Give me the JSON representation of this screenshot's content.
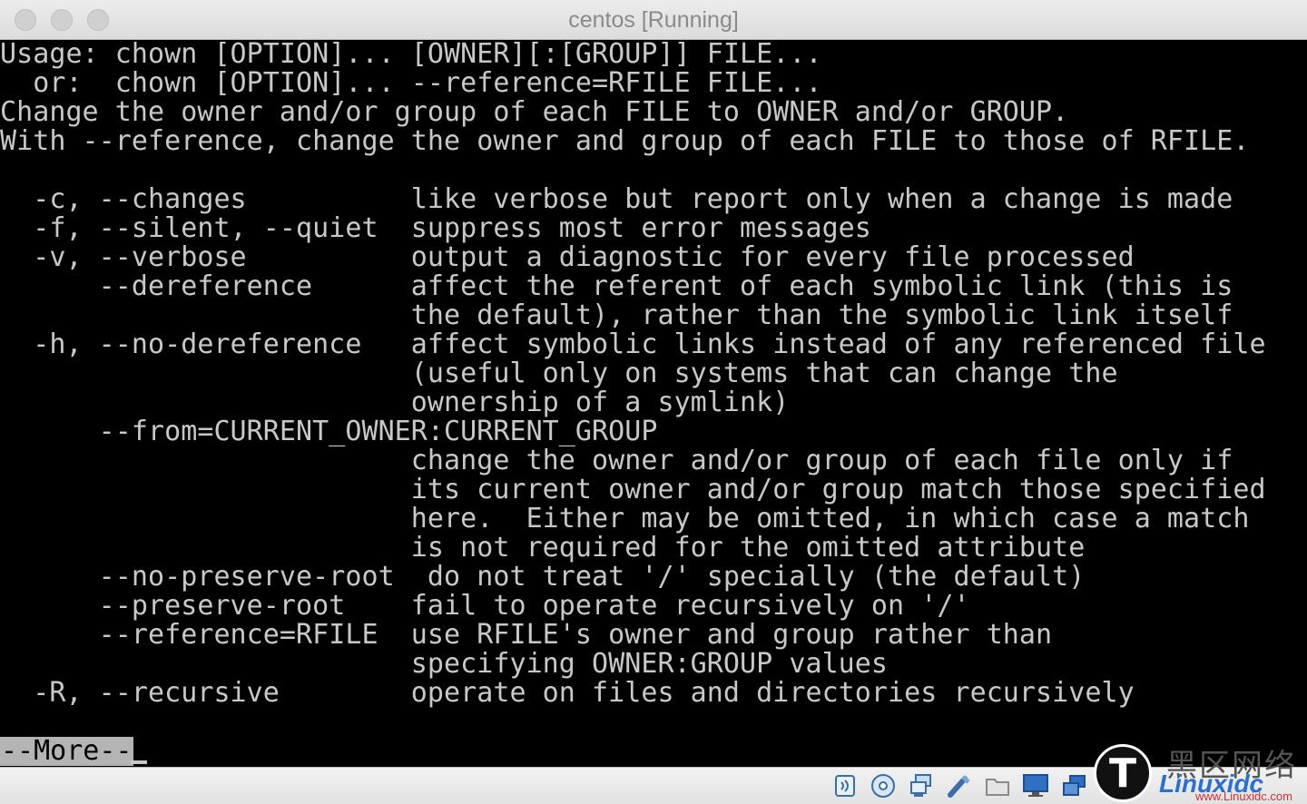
{
  "window": {
    "title": "centos [Running]"
  },
  "terminal": {
    "lines": [
      "Usage: chown [OPTION]... [OWNER][:[GROUP]] FILE...",
      "  or:  chown [OPTION]... --reference=RFILE FILE...",
      "Change the owner and/or group of each FILE to OWNER and/or GROUP.",
      "With --reference, change the owner and group of each FILE to those of RFILE.",
      "",
      "  -c, --changes          like verbose but report only when a change is made",
      "  -f, --silent, --quiet  suppress most error messages",
      "  -v, --verbose          output a diagnostic for every file processed",
      "      --dereference      affect the referent of each symbolic link (this is",
      "                         the default), rather than the symbolic link itself",
      "  -h, --no-dereference   affect symbolic links instead of any referenced file",
      "                         (useful only on systems that can change the",
      "                         ownership of a symlink)",
      "      --from=CURRENT_OWNER:CURRENT_GROUP",
      "                         change the owner and/or group of each file only if",
      "                         its current owner and/or group match those specified",
      "                         here.  Either may be omitted, in which case a match",
      "                         is not required for the omitted attribute",
      "      --no-preserve-root  do not treat '/' specially (the default)",
      "      --preserve-root    fail to operate recursively on '/'",
      "      --reference=RFILE  use RFILE's owner and group rather than",
      "                         specifying OWNER:GROUP values",
      "  -R, --recursive        operate on files and directories recursively"
    ],
    "pager_prompt": "--More--"
  },
  "statusbar": {
    "icons": [
      "audio-icon",
      "optical-disc-icon",
      "network-icon",
      "usb-icon",
      "shared-folder-icon",
      "display-icon",
      "virtual-machine-icon",
      "mouse-integration-icon"
    ]
  },
  "watermark": {
    "logo": "T",
    "chinese": "黑区网络",
    "brand": "Linuxidc",
    "url": "www.Linuxidc.com"
  },
  "colors": {
    "terminal_bg": "#000000",
    "terminal_fg": "#c8c8c8",
    "prompt_bg": "#b4b4b4"
  }
}
